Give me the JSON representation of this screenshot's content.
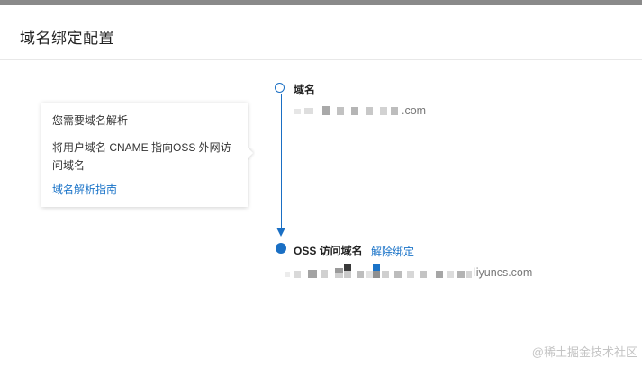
{
  "page": {
    "title": "域名绑定配置"
  },
  "callout": {
    "heading": "您需要域名解析",
    "description": "将用户域名 CNAME 指向OSS 外网访问域名",
    "link_label": "域名解析指南"
  },
  "steps": [
    {
      "label": "域名",
      "value_visible_suffix": ".com"
    },
    {
      "label": "OSS 访问域名",
      "action_label": "解除绑定",
      "value_visible_suffix": "liyuncs.com"
    }
  ],
  "watermark": "@稀土掘金技术社区",
  "colors": {
    "accent": "#1a6fc4",
    "link": "#1a73c8",
    "topbar": "#8a8a8a"
  }
}
